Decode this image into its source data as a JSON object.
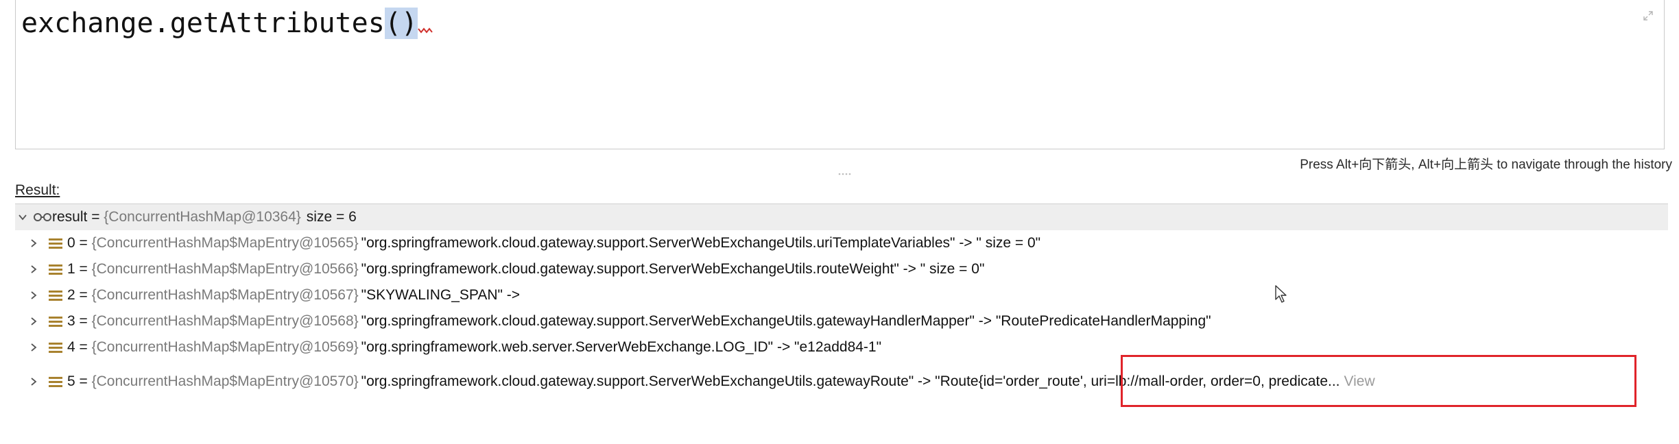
{
  "editor": {
    "expression_before": "exchange.getAttributes",
    "expression_parens": "()"
  },
  "history_hint": "Press Alt+向下箭头, Alt+向上箭头 to navigate through the history",
  "result_label": "Result:",
  "tree": {
    "root": {
      "name": "result",
      "eq": " = ",
      "type": "{ConcurrentHashMap@10364}",
      "value": "size = 6",
      "expanded": true,
      "icon": "watch-glasses-icon"
    },
    "entries": [
      {
        "index": "0",
        "eq": " = ",
        "type": "{ConcurrentHashMap$MapEntry@10565}",
        "value": "\"org.springframework.cloud.gateway.support.ServerWebExchangeUtils.uriTemplateVariables\" -> \" size = 0\"",
        "icon": "map-entry-icon"
      },
      {
        "index": "1",
        "eq": " = ",
        "type": "{ConcurrentHashMap$MapEntry@10566}",
        "value": "\"org.springframework.cloud.gateway.support.ServerWebExchangeUtils.routeWeight\" -> \" size = 0\"",
        "icon": "map-entry-icon"
      },
      {
        "index": "2",
        "eq": " = ",
        "type": "{ConcurrentHashMap$MapEntry@10567}",
        "value": "\"SKYWALING_SPAN\" ->",
        "icon": "map-entry-icon"
      },
      {
        "index": "3",
        "eq": " = ",
        "type": "{ConcurrentHashMap$MapEntry@10568}",
        "value": "\"org.springframework.cloud.gateway.support.ServerWebExchangeUtils.gatewayHandlerMapper\" -> \"RoutePredicateHandlerMapping\"",
        "icon": "map-entry-icon"
      },
      {
        "index": "4",
        "eq": " = ",
        "type": "{ConcurrentHashMap$MapEntry@10569}",
        "value": "\"org.springframework.web.server.ServerWebExchange.LOG_ID\" -> \"e12add84-1\"",
        "icon": "map-entry-icon"
      },
      {
        "index": "5",
        "eq": " = ",
        "type": "{ConcurrentHashMap$MapEntry@10570}",
        "value": "\"org.springframework.cloud.gateway.support.ServerWebExchangeUtils.gatewayRoute\" -> \"Route{id='order_route', uri=lb://mall-order, order=0, predicate...",
        "view_label": "View",
        "icon": "map-entry-icon"
      }
    ]
  },
  "colors": {
    "highlight_box": "#e0242a",
    "type_gray": "#7a7a7a",
    "root_row_bg": "#eeeeee",
    "entry_icon": "#a8822f",
    "paren_highlight": "#c5d7f0"
  }
}
